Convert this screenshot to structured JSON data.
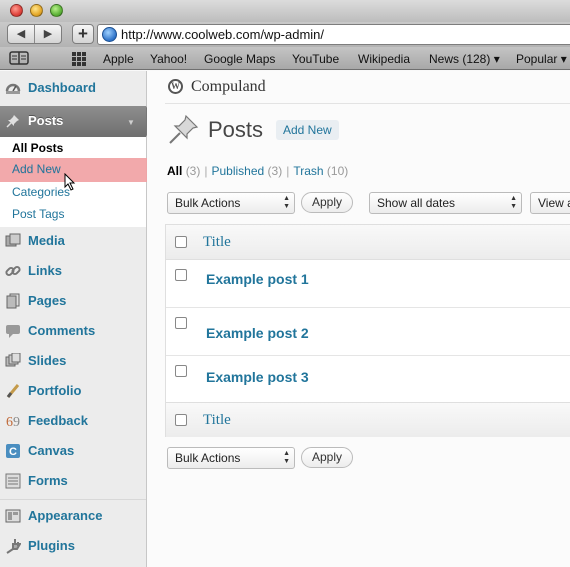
{
  "browser": {
    "url": "http://www.coolweb.com/wp-admin/",
    "nav_back": "◀",
    "nav_forward": "▶",
    "add_tab": "+",
    "bookmarks": [
      "Apple",
      "Yahoo!",
      "Google Maps",
      "YouTube",
      "Wikipedia",
      "News (128)",
      "Popular"
    ],
    "bookmark_arrow": "▾"
  },
  "sidebar": {
    "dashboard": "Dashboard",
    "posts": "Posts",
    "posts_submenu": [
      "All Posts",
      "Add New",
      "Categories",
      "Post Tags"
    ],
    "items": [
      "Media",
      "Links",
      "Pages",
      "Comments",
      "Slides",
      "Portfolio",
      "Feedback",
      "Canvas",
      "Forms"
    ],
    "items2": [
      "Appearance",
      "Plugins"
    ]
  },
  "header": {
    "site_logo": "W",
    "site_name": "Compuland",
    "page_title": "Posts",
    "add_new": "Add New"
  },
  "filters": {
    "all": "All",
    "all_count": "(3)",
    "published": "Published",
    "published_count": "(3)",
    "trash": "Trash",
    "trash_count": "(10)",
    "separator": "|"
  },
  "actions": {
    "bulk_actions": "Bulk Actions",
    "apply": "Apply",
    "show_dates": "Show all dates",
    "view": "View a"
  },
  "table": {
    "column_title": "Title",
    "posts": [
      "Example post 1",
      "Example post 2",
      "Example post 3"
    ]
  },
  "colors": {
    "link": "#21759b",
    "highlight": "#f1a2a4",
    "sidebar_active": "#777777"
  }
}
